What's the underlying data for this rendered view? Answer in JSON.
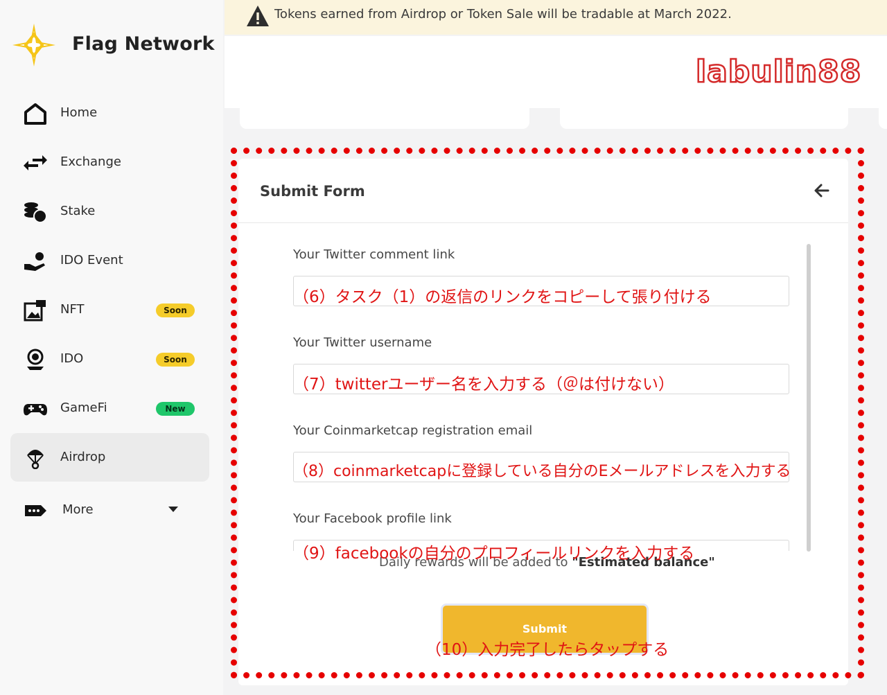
{
  "brand": {
    "name": "Flag Network"
  },
  "sidebar": {
    "items": [
      {
        "label": "Home",
        "icon": "home-icon"
      },
      {
        "label": "Exchange",
        "icon": "exchange-icon"
      },
      {
        "label": "Stake",
        "icon": "stake-coins-icon"
      },
      {
        "label": "IDO Event",
        "icon": "hand-coin-icon"
      },
      {
        "label": "NFT",
        "icon": "nft-image-icon",
        "badge": "Soon"
      },
      {
        "label": "IDO",
        "icon": "ido-icon",
        "badge": "Soon"
      },
      {
        "label": "GameFi",
        "icon": "gamepad-icon",
        "badge": "New"
      },
      {
        "label": "Airdrop",
        "icon": "parachute-icon",
        "active": true
      },
      {
        "label": "More",
        "icon": "tag-dots-icon"
      }
    ]
  },
  "notice": {
    "text": "Tokens earned from Airdrop or Token Sale will be tradable at March 2022.",
    "icon": "warning-icon"
  },
  "watermark": "labulin88",
  "form": {
    "title": "Submit Form",
    "fields": [
      {
        "label": "Your Twitter comment link",
        "annotation": "（6）タスク（1）の返信のリンクをコピーして張り付ける"
      },
      {
        "label": "Your Twitter username",
        "annotation": "（7）twitterユーザー名を入力する（＠は付けない）"
      },
      {
        "label": "Your Coinmarketcap registration email",
        "annotation": "（8）coinmarketcapに登録している自分のEメールアドレスを入力する"
      },
      {
        "label": "Your Facebook profile link",
        "annotation": "（9）facebookの自分のプロフィールリンクを入力する"
      }
    ],
    "daily_text": "Daily rewards will be added to ",
    "daily_highlight": "\"Estimated balance\"",
    "submit_label": "Submit",
    "submit_annotation": "（10）入力完了したらタップする"
  },
  "colors": {
    "accent_yellow": "#f0b72d",
    "annotation_red": "#e01414",
    "badge_soon": "#f5cc2a",
    "badge_new": "#1fc66a"
  }
}
